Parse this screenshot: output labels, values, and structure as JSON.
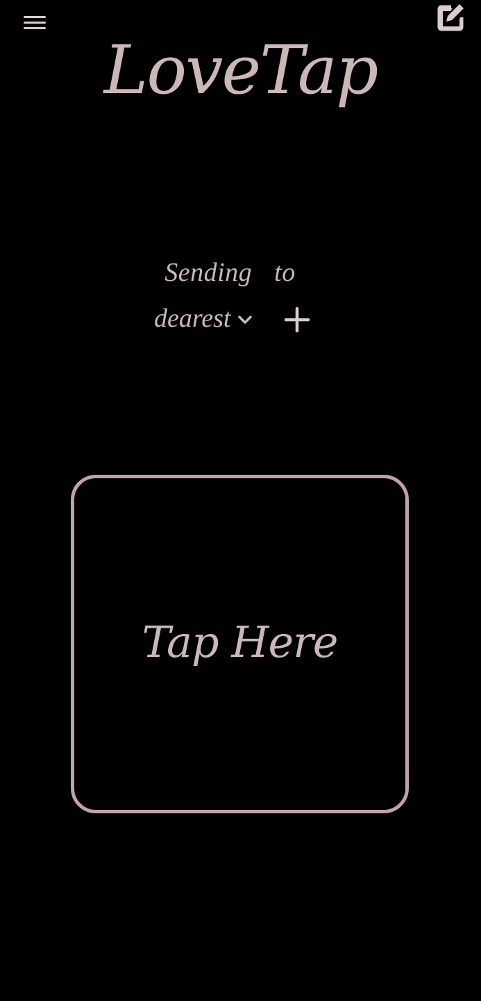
{
  "header": {
    "menu_icon": "hamburger-menu-icon",
    "edit_icon": "edit-note-icon",
    "title": "LoveTap"
  },
  "recipient": {
    "label": "Sending to",
    "selected": "dearest",
    "dropdown_icon": "chevron-down-icon",
    "add_icon": "plus-icon"
  },
  "tap_area": {
    "label": "Tap Here"
  },
  "colors": {
    "background": "#000000",
    "accent": "#cbb6b8",
    "border": "#bfa3a6",
    "icon": "#d9cccd"
  }
}
